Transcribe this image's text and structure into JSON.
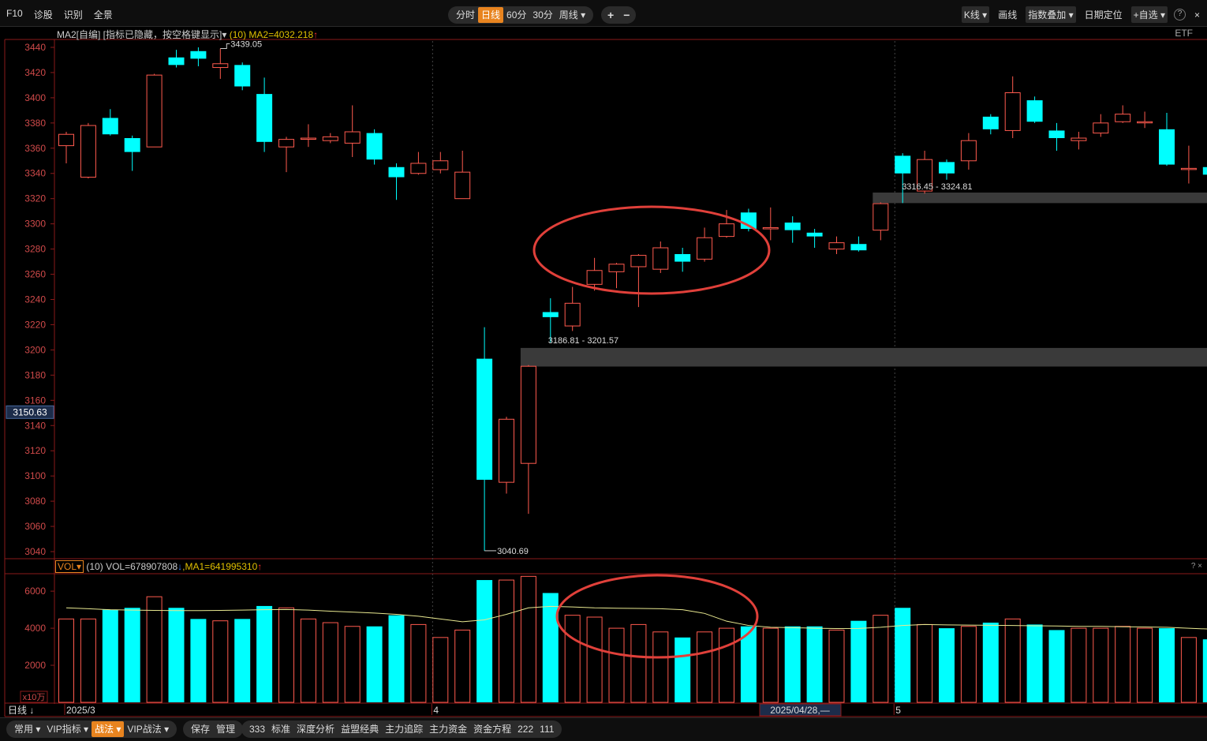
{
  "toolbar": {
    "left_items": [
      "F10",
      "诊股",
      "识别",
      "全景"
    ],
    "periods": [
      "分时",
      "日线",
      "60分",
      "30分",
      "周线 ▾"
    ],
    "active_period": "日线",
    "zoom": [
      "+",
      "−"
    ],
    "right_items": [
      "K线 ▾",
      "画线",
      "指数叠加 ▾",
      "日期定位",
      "+自选 ▾",
      "?",
      "×"
    ]
  },
  "main_info": {
    "prefix": "MA2[自编] [指标已隐藏，按空格键显示]▾",
    "param": "(10)",
    "value": "MA2=4032.218",
    "arrow": "↑",
    "right_label": "ETF"
  },
  "vol_info": {
    "tag": "VOL▾",
    "param": "(10)",
    "vol_text": "VOL=678907808",
    "vol_arrow": "↓",
    "ma_text": ",MA1=641995310",
    "ma_arrow": "↑",
    "help": "? ×"
  },
  "price_axis": {
    "ticks": [
      "3440",
      "3420",
      "3400",
      "3380",
      "3360",
      "3340",
      "3320",
      "3300",
      "3280",
      "3260",
      "3240",
      "3220",
      "3200",
      "3180",
      "3160",
      "3140",
      "3120",
      "3100",
      "3080",
      "3060",
      "3040"
    ],
    "current_label": "3150.63"
  },
  "vol_axis": {
    "ticks": [
      "6000",
      "4000",
      "2000"
    ],
    "unit": "x10万"
  },
  "date_axis": {
    "period_label": "日线",
    "labels": [
      "2025/3",
      "4",
      "5"
    ],
    "cursor_date": "2025/04/28,—"
  },
  "annotations": {
    "high_label": "3439.05",
    "low_label": "3040.69",
    "gap1_label": "3186.81 - 3201.57",
    "gap2_label": "3316.45 - 3324.81"
  },
  "colors": {
    "up": "#ff5a4e",
    "down": "#00ffff",
    "ma": "#e8e890",
    "circle": "#e0403a",
    "gap": "#3a3a3a"
  },
  "bottombar": {
    "group1": [
      "常用 ▾",
      "VIP指标 ▾",
      "战法 ▾",
      "VIP战法 ▾"
    ],
    "active": "战法 ▾",
    "group2": [
      "保存",
      "管理"
    ],
    "group3": [
      "333",
      "标准",
      "深度分析",
      "益盟经典",
      "主力追踪",
      "主力资金",
      "资金方程",
      "222",
      "111"
    ]
  },
  "chart_data": {
    "type": "candlestick",
    "ylim": [
      3035,
      3445
    ],
    "vol_ylim": [
      0,
      6900
    ],
    "candles": [
      {
        "o": 3362,
        "c": 3371,
        "h": 3373,
        "l": 3348,
        "v": 4500
      },
      {
        "o": 3337,
        "c": 3378,
        "h": 3380,
        "l": 3336,
        "v": 4500
      },
      {
        "o": 3384,
        "c": 3371,
        "h": 3391,
        "l": 3370,
        "v": 5000
      },
      {
        "o": 3368,
        "c": 3357,
        "h": 3370,
        "l": 3342,
        "v": 5100
      },
      {
        "o": 3361,
        "c": 3418,
        "h": 3419,
        "l": 3361,
        "v": 5700
      },
      {
        "o": 3432,
        "c": 3426,
        "h": 3438,
        "l": 3424,
        "v": 5100
      },
      {
        "o": 3437,
        "c": 3431,
        "h": 3440,
        "l": 3425,
        "v": 4500
      },
      {
        "o": 3424,
        "c": 3427,
        "h": 3439.05,
        "l": 3415,
        "v": 4400
      },
      {
        "o": 3426,
        "c": 3409,
        "h": 3428,
        "l": 3406,
        "v": 4500
      },
      {
        "o": 3403,
        "c": 3365,
        "h": 3416,
        "l": 3357,
        "v": 5200
      },
      {
        "o": 3361,
        "c": 3367,
        "h": 3369,
        "l": 3341,
        "v": 5100
      },
      {
        "o": 3368,
        "c": 3368,
        "h": 3379,
        "l": 3361,
        "v": 4500
      },
      {
        "o": 3366,
        "c": 3369,
        "h": 3372,
        "l": 3364,
        "v": 4300
      },
      {
        "o": 3364,
        "c": 3373,
        "h": 3394,
        "l": 3353,
        "v": 4100
      },
      {
        "o": 3372,
        "c": 3351,
        "h": 3375,
        "l": 3347,
        "v": 4100
      },
      {
        "o": 3345,
        "c": 3337,
        "h": 3348,
        "l": 3319,
        "v": 4700
      },
      {
        "o": 3340,
        "c": 3348,
        "h": 3357,
        "l": 3339,
        "v": 4200
      },
      {
        "o": 3343,
        "c": 3350,
        "h": 3357,
        "l": 3340,
        "v": 3500
      },
      {
        "o": 3320,
        "c": 3341,
        "h": 3358,
        "l": 3320,
        "v": 3900
      },
      {
        "o": 3193,
        "c": 3097,
        "h": 3218,
        "l": 3040.69,
        "v": 6600
      },
      {
        "o": 3095,
        "c": 3145,
        "h": 3147,
        "l": 3086,
        "v": 6600
      },
      {
        "o": 3110,
        "c": 3187,
        "h": 3188,
        "l": 3070,
        "v": 6800
      },
      {
        "o": 3230,
        "c": 3226,
        "h": 3241,
        "l": 3206,
        "v": 5900
      },
      {
        "o": 3219,
        "c": 3237,
        "h": 3250,
        "l": 3215,
        "v": 4700
      },
      {
        "o": 3252,
        "c": 3263,
        "h": 3273,
        "l": 3247,
        "v": 4600
      },
      {
        "o": 3262,
        "c": 3268,
        "h": 3269,
        "l": 3249,
        "v": 4000
      },
      {
        "o": 3266,
        "c": 3275,
        "h": 3276,
        "l": 3234,
        "v": 4200
      },
      {
        "o": 3264,
        "c": 3281,
        "h": 3286,
        "l": 3261,
        "v": 3800
      },
      {
        "o": 3276,
        "c": 3270,
        "h": 3281,
        "l": 3262,
        "v": 3500
      },
      {
        "o": 3272,
        "c": 3289,
        "h": 3297,
        "l": 3270,
        "v": 3800
      },
      {
        "o": 3290,
        "c": 3300,
        "h": 3311,
        "l": 3289,
        "v": 4000
      },
      {
        "o": 3309,
        "c": 3296,
        "h": 3312,
        "l": 3294,
        "v": 4100
      },
      {
        "o": 3296,
        "c": 3297,
        "h": 3313,
        "l": 3287,
        "v": 4000
      },
      {
        "o": 3301,
        "c": 3295,
        "h": 3306,
        "l": 3285,
        "v": 4100
      },
      {
        "o": 3293,
        "c": 3290,
        "h": 3296,
        "l": 3281,
        "v": 4100
      },
      {
        "o": 3280,
        "c": 3285,
        "h": 3290,
        "l": 3276,
        "v": 3900
      },
      {
        "o": 3284,
        "c": 3279,
        "h": 3290,
        "l": 3278,
        "v": 4400
      },
      {
        "o": 3295,
        "c": 3316,
        "h": 3317,
        "l": 3287,
        "v": 4700
      },
      {
        "o": 3354,
        "c": 3340,
        "h": 3356,
        "l": 3316.45,
        "v": 5100
      },
      {
        "o": 3326,
        "c": 3351,
        "h": 3358,
        "l": 3324,
        "v": 4200
      },
      {
        "o": 3349,
        "c": 3340,
        "h": 3351,
        "l": 3335,
        "v": 4000
      },
      {
        "o": 3350,
        "c": 3366,
        "h": 3372,
        "l": 3343,
        "v": 4100
      },
      {
        "o": 3385,
        "c": 3375,
        "h": 3387,
        "l": 3371,
        "v": 4300
      },
      {
        "o": 3374,
        "c": 3404,
        "h": 3417,
        "l": 3368,
        "v": 4500
      },
      {
        "o": 3398,
        "c": 3381,
        "h": 3401,
        "l": 3380,
        "v": 4200
      },
      {
        "o": 3374,
        "c": 3368,
        "h": 3380,
        "l": 3358,
        "v": 3900
      },
      {
        "o": 3366,
        "c": 3368,
        "h": 3373,
        "l": 3359,
        "v": 4000
      },
      {
        "o": 3372,
        "c": 3380,
        "h": 3387,
        "l": 3369,
        "v": 4000
      },
      {
        "o": 3381,
        "c": 3387,
        "h": 3394,
        "l": 3380,
        "v": 4100
      },
      {
        "o": 3381,
        "c": 3381,
        "h": 3389,
        "l": 3376,
        "v": 4000
      },
      {
        "o": 3375,
        "c": 3347,
        "h": 3388,
        "l": 3346,
        "v": 4000
      },
      {
        "o": 3344,
        "c": 3344,
        "h": 3362,
        "l": 3332,
        "v": 3500
      },
      {
        "o": 3345,
        "c": 3339,
        "h": 3354,
        "l": 3333,
        "v": 3400
      }
    ],
    "vol_ma": [
      5100,
      5050,
      5000,
      4980,
      4960,
      4950,
      4950,
      4960,
      4980,
      5000,
      5010,
      4980,
      4920,
      4870,
      4820,
      4750,
      4650,
      4500,
      4350,
      4450,
      4750,
      5100,
      5180,
      5150,
      5100,
      5080,
      5070,
      5050,
      5000,
      4800,
      4380,
      4150,
      4050,
      4030,
      4000,
      3980,
      3990,
      4050,
      4150,
      4200,
      4180,
      4170,
      4160,
      4150,
      4130,
      4120,
      4100,
      4100,
      4080,
      4070,
      4050,
      4000,
      3950
    ],
    "gaps": [
      {
        "low": 3186.81,
        "high": 3201.57,
        "from_index": 21
      },
      {
        "low": 3316.45,
        "high": 3324.81,
        "from_index": 37
      }
    ],
    "date_labels": [
      {
        "index": 0,
        "text": "2025/3"
      },
      {
        "index": 16,
        "text": "4"
      },
      {
        "index": 37,
        "text": "5"
      }
    ]
  }
}
